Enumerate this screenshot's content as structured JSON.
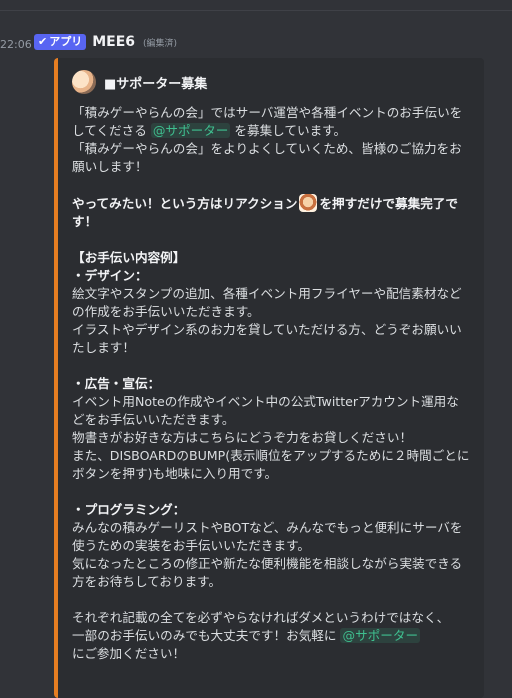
{
  "message": {
    "timestamp": "22:06",
    "app_badge": "アプリ",
    "username": "MEE6",
    "edited": "(編集済)"
  },
  "embed": {
    "author_icon": "avatar-icon",
    "author_name": "■サポーター募集",
    "accent_color": "#e67e22",
    "lines": {
      "p1a": "「積みゲーやらんの会」ではサーバ運営や各種イベントのお手伝いをしてくださる ",
      "p1_mention": "@サポーター",
      "p1b": " を募集しています。",
      "p2": "「積みゲーやらんの会」をよりよくしていくため、皆様のご協力をお願いします！",
      "p3a": "やってみたい！という方はリアクション",
      "p3_emoji": "reaction-emoji-icon",
      "p3b": "を押すだけで募集完了です！",
      "section_title": "【お手伝い内容例】",
      "design_head": "・デザイン：",
      "design_1": "絵文字やスタンプの追加、各種イベント用フライヤーや配信素材などの作成をお手伝いいただきます。",
      "design_2": "イラストやデザイン系のお力を貸していただける方、どうぞお願いいたします！",
      "ad_head": "・広告・宣伝：",
      "ad_1": "イベント用Noteの作成やイベント中の公式Twitterアカウント運用などをお手伝いいただきます。",
      "ad_2": "物書きがお好きな方はこちらにどうぞ力をお貸しください！",
      "ad_3": "また、DISBOARDのBUMP(表示順位をアップするために２時間ごとにボタンを押す)も地味に入り用です。",
      "prog_head": "・プログラミング：",
      "prog_1": "みんなの積みゲーリストやBOTなど、みんなでもっと便利にサーバを使うための実装をお手伝いいただきます。",
      "prog_2": "気になったところの修正や新たな便利機能を相談しながら実装できる方をお待ちしております。",
      "closing_1": "それぞれ記載の全てを必ずやらなければダメというわけではなく、",
      "closing_2a": "一部のお手伝いのみでも大丈夫です！お気軽に ",
      "closing_mention": "@サポーター",
      "closing_2b": "にご参加ください！"
    }
  }
}
